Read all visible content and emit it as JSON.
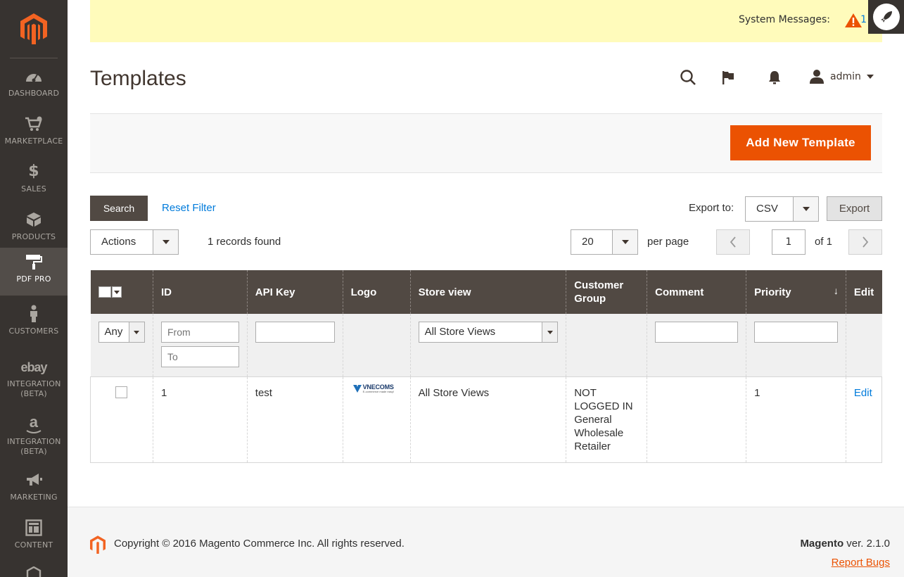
{
  "sidebar": {
    "items": [
      {
        "label": "Dashboard",
        "icon": "gauge-icon"
      },
      {
        "label": "Marketplace",
        "icon": "cart-icon"
      },
      {
        "label": "Sales",
        "icon": "dollar-icon"
      },
      {
        "label": "Products",
        "icon": "box-icon"
      },
      {
        "label": "PDF Pro",
        "icon": "paint-roller-icon"
      },
      {
        "label": "Customers",
        "icon": "person-icon"
      },
      {
        "label": "Integration (Beta)",
        "icon": "ebay-icon"
      },
      {
        "label": "Integration (Beta)",
        "icon": "amazon-icon"
      },
      {
        "label": "Marketing",
        "icon": "megaphone-icon"
      },
      {
        "label": "Content",
        "icon": "layout-icon"
      }
    ]
  },
  "notice": {
    "label": "System Messages:",
    "count": "1"
  },
  "header": {
    "title": "Templates",
    "user": "admin"
  },
  "actions": {
    "add_label": "Add New Template"
  },
  "toolbar": {
    "search_label": "Search",
    "reset_label": "Reset Filter",
    "export_to_label": "Export to:",
    "export_format": "CSV",
    "export_label": "Export",
    "mass_actions": "Actions",
    "records": "1 records found",
    "per_page_value": "20",
    "per_page_label": "per page",
    "page_current": "1",
    "page_total": "of 1"
  },
  "table": {
    "headers": {
      "id": "ID",
      "api_key": "API Key",
      "logo": "Logo",
      "store_view": "Store view",
      "customer_group": "Customer Group",
      "comment": "Comment",
      "priority": "Priority",
      "edit": "Edit"
    },
    "filters": {
      "any": "Any",
      "from_placeholder": "From",
      "to_placeholder": "To",
      "store_view": "All Store Views"
    },
    "rows": [
      {
        "id": "1",
        "api_key": "test",
        "logo_text": "VNECOMS",
        "logo_tagline": "E-commerce made easy!",
        "store_view": "All Store Views",
        "customer_group": [
          "NOT LOGGED IN",
          "General",
          "Wholesale",
          "Retailer"
        ],
        "comment": "",
        "priority": "1",
        "edit": "Edit"
      }
    ]
  },
  "footer": {
    "copyright": "Copyright © 2016 Magento Commerce Inc. All rights reserved.",
    "brand": "Magento",
    "version": "ver. 2.1.0",
    "report_bugs": "Report Bugs"
  },
  "colors": {
    "accent": "#eb5202",
    "sidebar": "#373330",
    "header": "#514943",
    "link": "#007bdb",
    "notice": "#fffbbb"
  }
}
